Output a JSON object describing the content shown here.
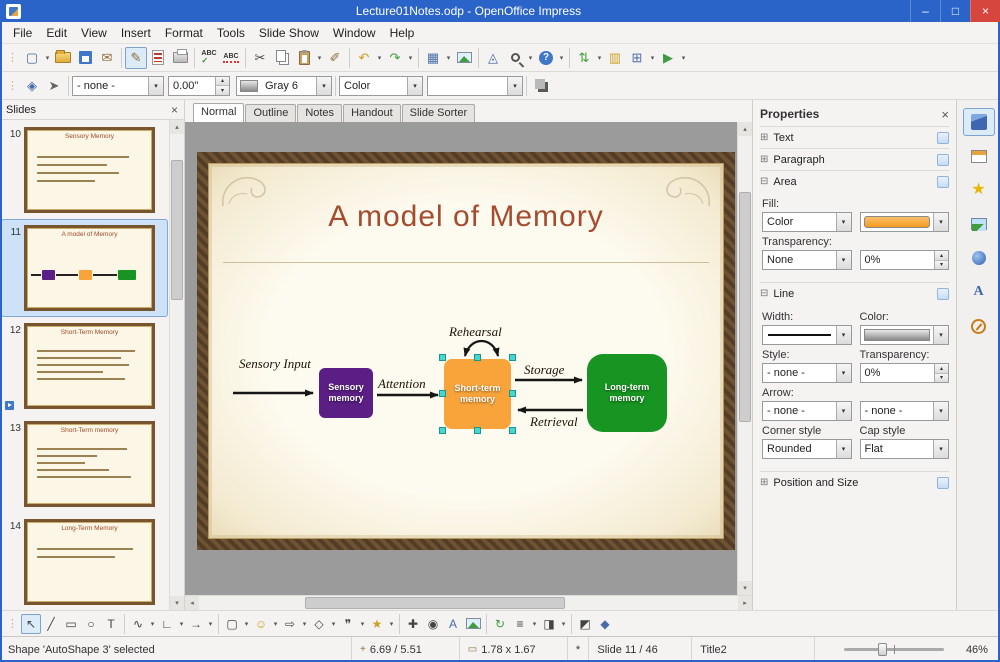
{
  "window": {
    "title": "Lecture01Notes.odp - OpenOffice Impress",
    "minimize": "–",
    "maximize": "□",
    "close": "×"
  },
  "menu": {
    "items": [
      "File",
      "Edit",
      "View",
      "Insert",
      "Format",
      "Tools",
      "Slide Show",
      "Window",
      "Help"
    ]
  },
  "icons": {
    "grip": "⋮",
    "down": "▾",
    "up": "▴",
    "left": "◂",
    "right": "▸",
    "close": "×",
    "plus": "⊞",
    "minus": "⊟",
    "check": "✓",
    "new": "▢",
    "email": "✉",
    "edit": "✎",
    "spell": "ABC",
    "autospell": "ABC",
    "cut": "✂",
    "clone": "✐",
    "undo": "↶",
    "redo": "↷",
    "table": "▦",
    "draw": "◬",
    "help": "?",
    "navigator": "⇅",
    "gallery": "▥",
    "grid": "⊞",
    "slideshow": "▶",
    "styles": "◈",
    "pointer": "➤",
    "select": "↖",
    "line": "╱",
    "rect": "▭",
    "ellipse": "○",
    "text": "T",
    "curve": "∿",
    "connector": "∟",
    "arrowline": "→",
    "basic": "▢",
    "symbol": "☺",
    "blockarrow": "⇨",
    "flowchart": "◇",
    "callout": "❞",
    "star": "★",
    "points": "✚",
    "glue": "◉",
    "fontwork": "A",
    "rotate": "↻",
    "align": "≡",
    "arrange": "◨",
    "extrusion": "◩",
    "interaction": "◆",
    "position": "+",
    "size": "▭"
  },
  "toolbar2": {
    "line_style": "- none -",
    "line_width": "0.00\"",
    "line_color": "Gray 6",
    "area_style": "Color"
  },
  "tabs": {
    "items": [
      "Normal",
      "Outline",
      "Notes",
      "Handout",
      "Slide Sorter"
    ]
  },
  "slides_panel": {
    "title": "Slides",
    "slides": [
      {
        "number": "10",
        "title": "Sensory Memory"
      },
      {
        "number": "11",
        "title": "A model of Memory"
      },
      {
        "number": "12",
        "title": "Short-Term Memory"
      },
      {
        "number": "13",
        "title": "Short-Term memory"
      },
      {
        "number": "14",
        "title": "Long-Term Memory"
      }
    ]
  },
  "slide": {
    "title": "A model of Memory",
    "labels": {
      "input": "Sensory Input",
      "attention": "Attention",
      "rehearsal": "Rehearsal",
      "storage": "Storage",
      "retrieval": "Retrieval"
    },
    "boxes": {
      "sensory": "Sensory memory",
      "short": "Short-term memory",
      "long": "Long-term memory"
    },
    "colors": {
      "sensory": "#5a1e84",
      "short": "#f9a43b",
      "long": "#179421"
    }
  },
  "properties": {
    "title": "Properties",
    "sections": {
      "text": "Text",
      "paragraph": "Paragraph",
      "area": "Area",
      "line": "Line",
      "possize": "Position and Size"
    },
    "area": {
      "fill_label": "Fill:",
      "fill_type": "Color",
      "transparency_label": "Transparency:",
      "transparency_type": "None",
      "transparency_value": "0%"
    },
    "line": {
      "width_label": "Width:",
      "color_label": "Color:",
      "style_label": "Style:",
      "style": "- none -",
      "transparency_label": "Transparency:",
      "transparency": "0%",
      "arrow_label": "Arrow:",
      "arrow_start": "- none -",
      "arrow_end": "- none -",
      "corner_label": "Corner style",
      "corner": "Rounded",
      "cap_label": "Cap style",
      "cap": "Flat"
    }
  },
  "statusbar": {
    "message": "Shape 'AutoShape 3' selected",
    "position": "6.69 / 5.51",
    "size": "1.78 x 1.67",
    "modified": "*",
    "slide": "Slide 11 / 46",
    "style": "Title2",
    "zoom": "46%"
  }
}
